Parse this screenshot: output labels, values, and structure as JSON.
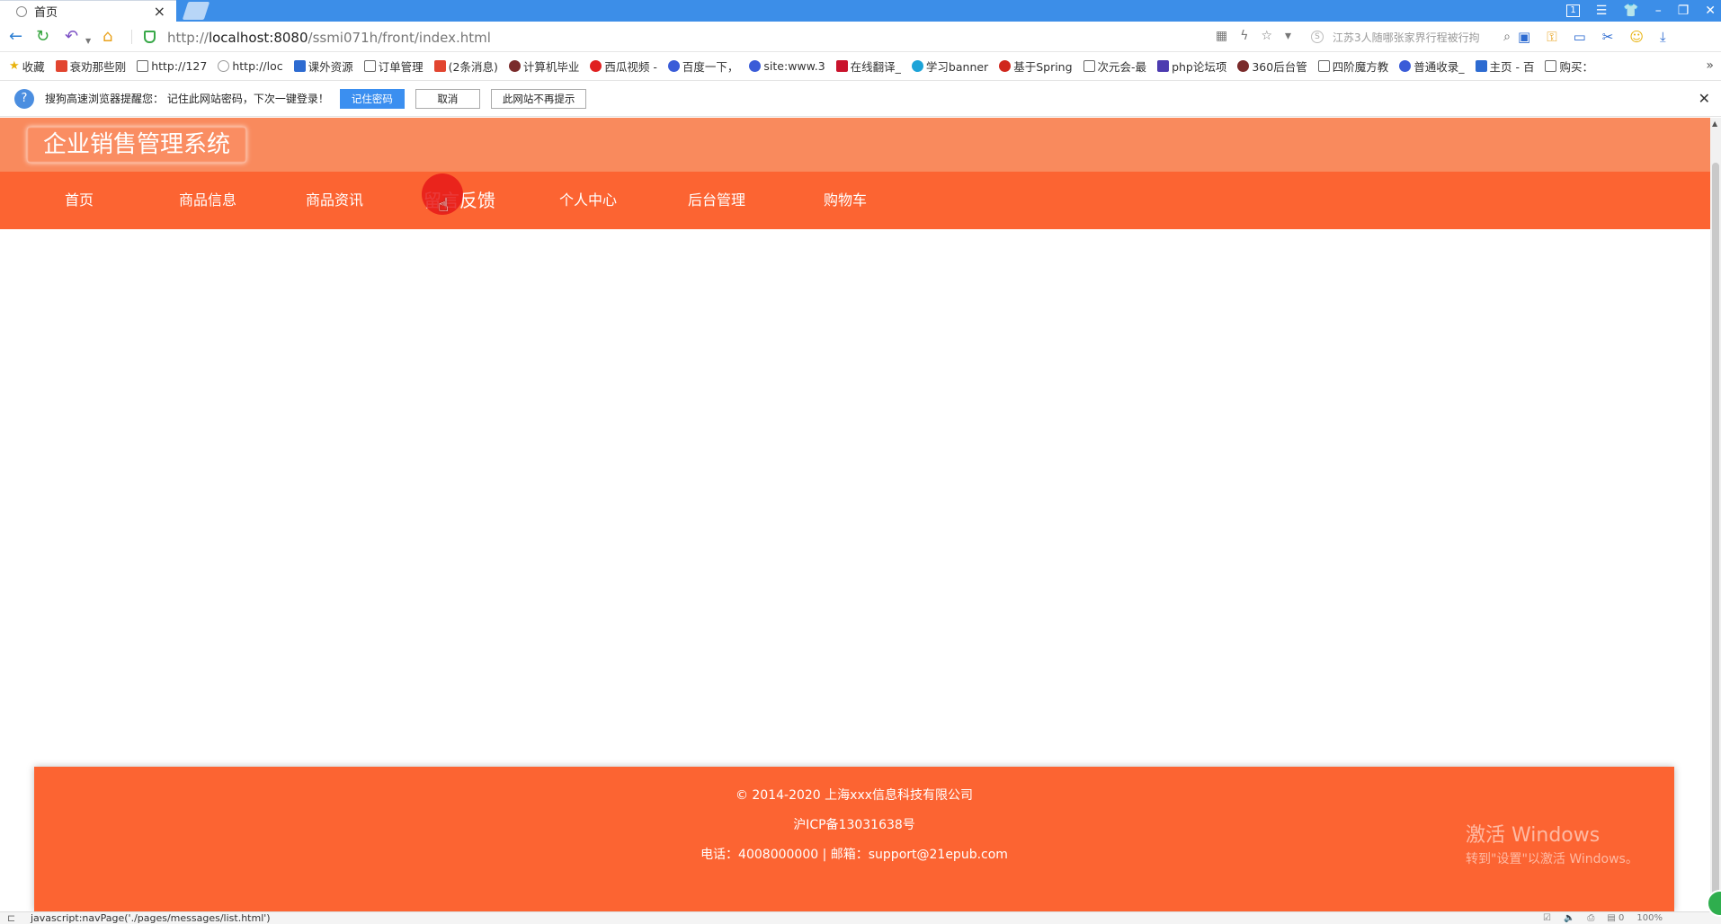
{
  "browser": {
    "tab_title": "首页",
    "url_prefix": "http://",
    "url_host": "localhost:8080",
    "url_path": "/ssmi071h/front/index.html",
    "search_placeholder": "江苏3人随哪张家界行程被行拘",
    "bookmarks": [
      {
        "label": "收藏",
        "icon": "star-icon"
      },
      {
        "label": "衰劝那些刚",
        "icon": "c-logo-icon"
      },
      {
        "label": "http://127",
        "icon": "doc-icon"
      },
      {
        "label": "http://loc",
        "icon": "globe-icon"
      },
      {
        "label": "课外资源",
        "icon": "book-icon"
      },
      {
        "label": "订单管理",
        "icon": "doc-icon"
      },
      {
        "label": "(2条消息)",
        "icon": "c-logo-icon"
      },
      {
        "label": "计算机毕业",
        "icon": "site-icon"
      },
      {
        "label": "西瓜视频 -",
        "icon": "play-icon"
      },
      {
        "label": "百度一下，",
        "icon": "paw-icon"
      },
      {
        "label": "site:www.3",
        "icon": "paw-icon"
      },
      {
        "label": "在线翻译_",
        "icon": "y-logo-icon"
      },
      {
        "label": "学习banner",
        "icon": "teal-logo-icon"
      },
      {
        "label": "基于Spring",
        "icon": "g-logo-icon"
      },
      {
        "label": "次元会-最",
        "icon": "doc-icon"
      },
      {
        "label": "php论坛项",
        "icon": "php-icon"
      },
      {
        "label": "360后台管",
        "icon": "site-icon"
      },
      {
        "label": "四阶魔方教",
        "icon": "doc-icon"
      },
      {
        "label": "普通收录_",
        "icon": "paw-icon"
      },
      {
        "label": "主页 - 百",
        "icon": "chart-icon"
      },
      {
        "label": "购买：",
        "icon": "doc-icon"
      }
    ],
    "password_prompt": {
      "text": "搜狗高速浏览器提醒您： 记住此网站密码，下次一键登录！",
      "remember_label": "记住密码",
      "cancel_label": "取消",
      "never_label": "此网站不再提示"
    },
    "status_url": "javascript:navPage('./pages/messages/list.html')",
    "zoom": "100%"
  },
  "site": {
    "title": "企业销售管理系统",
    "nav": [
      {
        "label": "首页"
      },
      {
        "label": "商品信息"
      },
      {
        "label": "商品资讯"
      },
      {
        "label": "留言反馈"
      },
      {
        "label": "个人中心"
      },
      {
        "label": "后台管理"
      },
      {
        "label": "购物车"
      }
    ],
    "active_nav_index": 3
  },
  "footer": {
    "copyright": "© 2014-2020 上海xxx信息科技有限公司",
    "icp": "沪ICP备13031638号",
    "contact": "电话：4008000000 | 邮箱：support@21epub.com"
  },
  "watermark": {
    "line1": "激活 Windows",
    "line2": "转到\"设置\"以激活 Windows。"
  },
  "colors": {
    "header_bg": "#f98a5d",
    "nav_bg": "#fc6432",
    "footer_bg": "#fc6432",
    "browser_title_bg": "#3c8ee8",
    "primary_button": "#3b8ff0"
  }
}
